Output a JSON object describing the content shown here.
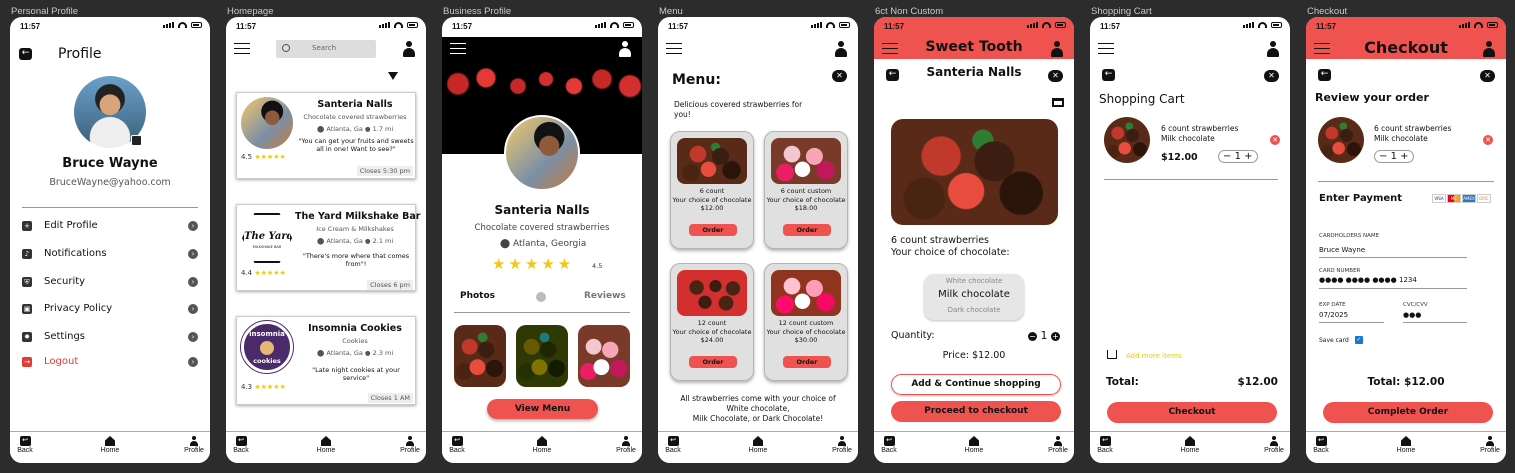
{
  "status": {
    "time": "11:57"
  },
  "frames": {
    "f1": "Personal Profile",
    "f2": "Homepage",
    "f3": "Business Profile",
    "f4": "Menu",
    "f5": "6ct Non Custom",
    "f6": "Shopping Cart",
    "f7": "Checkout"
  },
  "nav": {
    "back": "Back",
    "home": "Home",
    "profile": "Profile"
  },
  "profile": {
    "title": "Profile",
    "name": "Bruce Wayne",
    "email": "BruceWayne@yahoo.com",
    "menu": [
      {
        "label": "Edit Profile",
        "icon": "edit-user-icon"
      },
      {
        "label": "Notifications",
        "icon": "bell-icon"
      },
      {
        "label": "Security",
        "icon": "shield-icon"
      },
      {
        "label": "Privacy Policy",
        "icon": "lock-icon"
      },
      {
        "label": "Settings",
        "icon": "gear-icon"
      }
    ],
    "logout": "Logout"
  },
  "home": {
    "search_placeholder": "Search",
    "cards": [
      {
        "name": "Santeria Nalls",
        "sub": "Chocolate covered strawberries",
        "loc": "Atlanta, Ga",
        "dist": "1.7 mi",
        "quote": "\"You can get your fruits and sweets all in one! Want to see?\"",
        "rating": "4.5",
        "closes": "Closes 5:30 pm"
      },
      {
        "name": "The Yard Milkshake Bar",
        "sub": "Ice Cream & Milkshakes",
        "loc": "Atlanta, Ga",
        "dist": "2.1 mi",
        "quote": "\"There's more where that comes from\"!",
        "rating": "4.4",
        "closes": "Closes 6 pm"
      },
      {
        "name": "Insomnia Cookies",
        "sub": "Cookies",
        "loc": "Atlanta, Ga",
        "dist": "2.3 mi",
        "quote": "\"Late night cookies at your service\"",
        "rating": "4.3",
        "closes": "Closes 1 AM"
      }
    ],
    "logos": {
      "yard_text": "The Yard",
      "yard_sub": "MILKSHAKE BAR",
      "insomnia_top": "insomnia",
      "insomnia_bot": "cookies"
    }
  },
  "business": {
    "name": "Santeria Nalls",
    "sub": "Chocolate covered strawberries",
    "loc": "Atlanta, Georgia",
    "rating": "4.5",
    "tab_photos": "Photos",
    "tab_reviews": "Reviews",
    "view_menu": "View Menu"
  },
  "menu": {
    "title": "Menu:",
    "intro": "Delicious covered strawberries for you!",
    "items": [
      {
        "title": "6 count",
        "desc": "Your choice of chocolate",
        "price": "$12.00",
        "order": "Order"
      },
      {
        "title": "6 count custom",
        "desc": "Your choice of chocolate",
        "price": "$18.00",
        "order": "Order"
      },
      {
        "title": "12 count",
        "desc": "Your choice of chocolate",
        "price": "$24.00",
        "order": "Order"
      },
      {
        "title": "12 count custom",
        "desc": "Your choice of chocolate",
        "price": "$30.00",
        "order": "Order"
      }
    ],
    "footer1": "All strawberries come with your choice of",
    "footer2": "White chocolate,",
    "footer3": "Milk Chocolate, or Dark Chocolate!"
  },
  "product": {
    "header": "Sweet Tooth",
    "shop": "Santeria Nalls",
    "desc1": "6 count strawberries",
    "desc2": "Your choice of chocolate:",
    "opt1": "White chocolate",
    "opt2": "Milk chocolate",
    "opt3": "Dark chocolate",
    "qty_label": "Quantity:",
    "qty": "1",
    "price": "Price: $12.00",
    "add_btn": "Add & Continue shopping",
    "checkout_btn": "Proceed to checkout"
  },
  "cart": {
    "title": "Shopping Cart",
    "item1": "6 count strawberries",
    "item2": "Milk chocolate",
    "price": "$12.00",
    "qty": "1",
    "add_more": "Add more items",
    "total_label": "Total:",
    "total": "$12.00",
    "checkout": "Checkout"
  },
  "checkout": {
    "header": "Checkout",
    "review": "Review your order",
    "item1": "6 count strawberries",
    "item2": "Milk chocolate",
    "qty": "1",
    "payment": "Enter Payment",
    "cardholder_label": "CARDHOLDERS NAME",
    "cardholder": "Bruce Wayne",
    "card_label": "CARD NUMBER",
    "card_mask": "●●●●  ●●●●  ●●●●",
    "card_last": "1234",
    "exp_label": "EXP DATE",
    "exp": "07/2025",
    "cvc_label": "CVC/CVV",
    "cvc": "●●●",
    "save": "Save card",
    "total": "Total: $12.00",
    "complete": "Complete Order",
    "cards": [
      "VISA",
      "MC",
      "AMEX",
      "DISC"
    ]
  },
  "colors": {
    "accent": "#ef5350",
    "star": "#f5c518",
    "bg": "#2c2c2c"
  }
}
